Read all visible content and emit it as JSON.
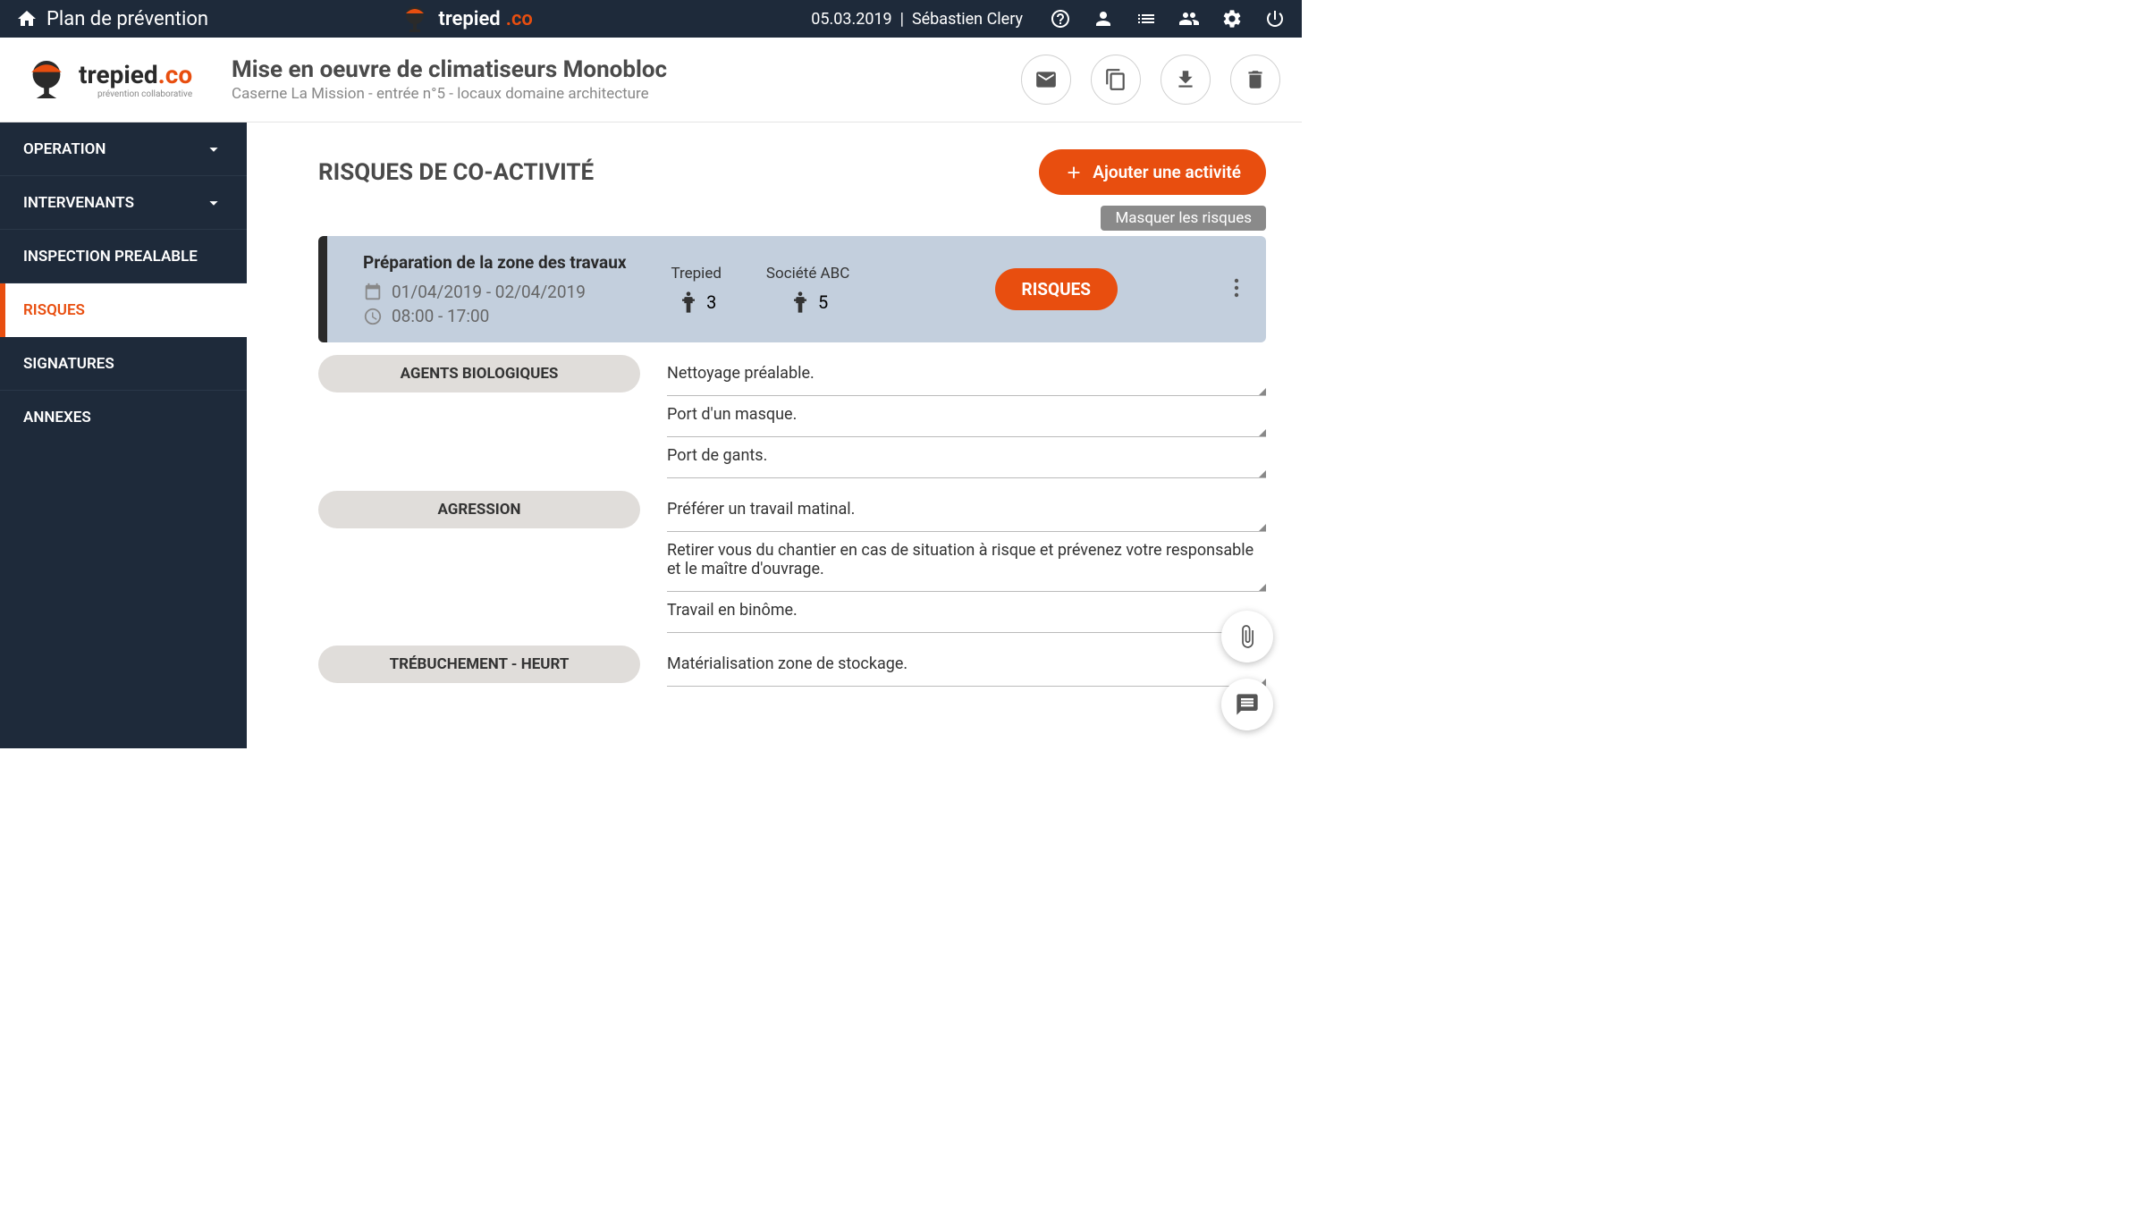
{
  "topbar": {
    "page_title": "Plan de prévention",
    "brand_t": "trepied",
    "brand_co": ".co",
    "date": "05.03.2019",
    "user": "Sébastien Clery"
  },
  "subheader": {
    "brand_t": "trepied",
    "brand_co": ".co",
    "brand_sub": "prévention collaborative",
    "title": "Mise en oeuvre de climatiseurs Monobloc",
    "subtitle": "Caserne La Mission - entrée n°5 - locaux domaine architecture"
  },
  "sidebar": {
    "items": [
      {
        "label": "OPERATION",
        "chevron": true
      },
      {
        "label": "INTERVENANTS",
        "chevron": true
      },
      {
        "label": "INSPECTION PREALABLE",
        "chevron": false
      },
      {
        "label": "RISQUES",
        "chevron": false,
        "active": true
      },
      {
        "label": "SIGNATURES",
        "chevron": false
      },
      {
        "label": "ANNEXES",
        "chevron": false
      }
    ]
  },
  "main": {
    "heading": "RISQUES DE CO-ACTIVITÉ",
    "add_button": "Ajouter une activité",
    "hide_risks": "Masquer les risques",
    "activity": {
      "title": "Préparation de la zone des travaux",
      "dates": "01/04/2019 - 02/04/2019",
      "hours": "08:00 - 17:00",
      "participants": [
        {
          "name": "Trepied",
          "count": "3"
        },
        {
          "name": "Société ABC",
          "count": "5"
        }
      ],
      "risks_button": "RISQUES"
    },
    "risks": [
      {
        "label": "AGENTS BIOLOGIQUES",
        "measures": [
          "Nettoyage préalable.",
          "Port d'un masque.",
          "Port de gants."
        ]
      },
      {
        "label": "AGRESSION",
        "measures": [
          "Préférer un travail matinal.",
          "Retirer vous du chantier en cas de situation à risque et prévenez votre responsable et le maître d'ouvrage.",
          "Travail en binôme."
        ]
      },
      {
        "label": "TRÉBUCHEMENT - HEURT",
        "measures": [
          "Matérialisation zone de stockage."
        ]
      }
    ]
  }
}
